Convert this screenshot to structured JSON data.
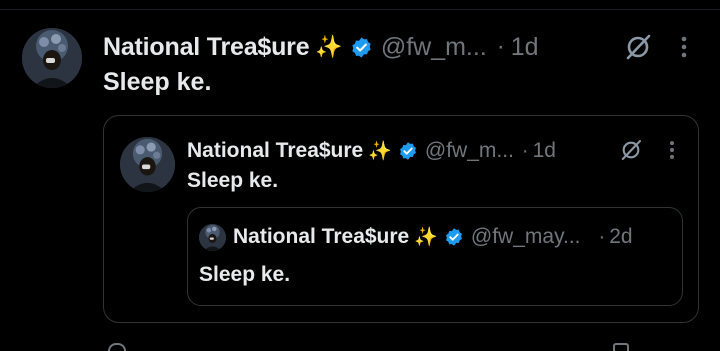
{
  "colors": {
    "background": "#000000",
    "text": "#e7e9ea",
    "muted": "#71767b",
    "border": "#2f3336",
    "verified": "#1d9bf0"
  },
  "icons": {
    "avatar": "avatar-icon",
    "sparkles": "sparkles-icon",
    "verified": "verified-badge-icon",
    "grok": "grok-icon",
    "more": "more-options-icon"
  },
  "post": {
    "author": {
      "name": "National Trea$ure",
      "emoji": "✨",
      "handle": "@fw_m..."
    },
    "separator": "·",
    "time": "1d",
    "text": "Sleep ke.",
    "quote": {
      "author": {
        "name": "National Trea$ure",
        "emoji": "✨",
        "handle": "@fw_m..."
      },
      "separator": "·",
      "time": "1d",
      "text": "Sleep ke.",
      "quote": {
        "author": {
          "name": "National Trea$ure",
          "emoji": "✨",
          "handle": "@fw_may..."
        },
        "separator": "·",
        "time": "2d",
        "text": "Sleep ke."
      }
    }
  }
}
